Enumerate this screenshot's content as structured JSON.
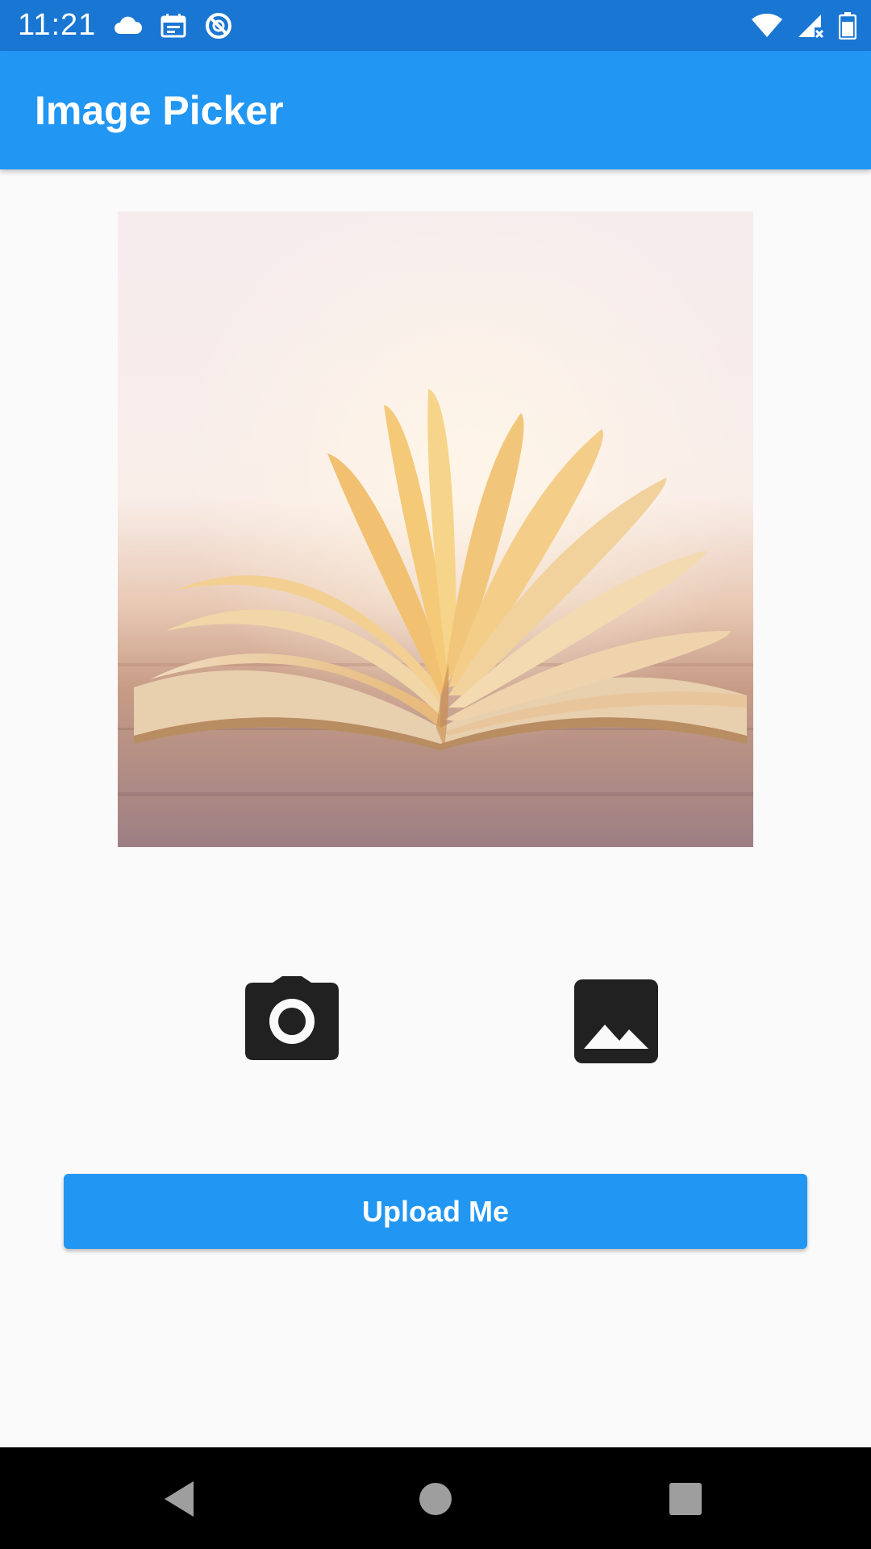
{
  "status_bar": {
    "time": "11:21",
    "left_icons": [
      "cloud-icon",
      "calendar-icon",
      "sync-disabled-icon"
    ],
    "right_icons": [
      "wifi-icon",
      "cell-signal-icon",
      "battery-icon"
    ]
  },
  "app_bar": {
    "title": "Image Picker"
  },
  "picked_image": {
    "subject": "open-book-photo"
  },
  "actions": {
    "camera_icon": "camera-icon",
    "gallery_icon": "image-icon"
  },
  "upload": {
    "label": "Upload Me"
  },
  "nav_bar": {
    "icons": [
      "back-icon",
      "home-icon",
      "recents-icon"
    ]
  },
  "colors": {
    "status_bar": "#1976d2",
    "app_bar": "#2196f3",
    "button": "#2196f3",
    "background": "#fafafa",
    "icon": "#212121"
  }
}
